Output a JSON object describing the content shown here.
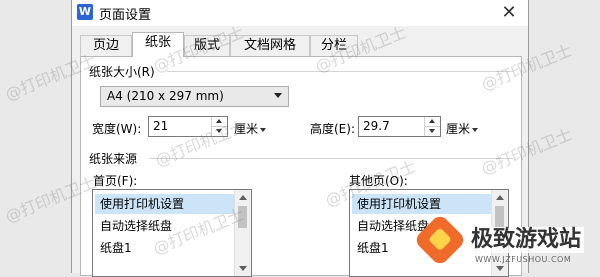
{
  "window": {
    "app_icon_letter": "W",
    "title": "页面设置",
    "close_glyph": "✕"
  },
  "tabs": [
    {
      "label": "页边距",
      "active": false
    },
    {
      "label": "纸张",
      "active": true
    },
    {
      "label": "版式",
      "active": false
    },
    {
      "label": "文档网格",
      "active": false
    },
    {
      "label": "分栏",
      "active": false
    }
  ],
  "paper_size": {
    "group_label": "纸张大小(R)",
    "selected": "A4 (210 x 297 mm)",
    "width_label": "宽度(W):",
    "width_value": "21",
    "width_unit": "厘米",
    "height_label": "高度(E):",
    "height_value": "29.7",
    "height_unit": "厘米"
  },
  "paper_source": {
    "group_label": "纸张来源",
    "first_page_label": "首页(F):",
    "first_page_items": [
      "使用打印机设置",
      "自动选择纸盘",
      "纸盘1"
    ],
    "other_pages_label": "其他页(O):",
    "other_pages_items": [
      "使用打印机设置",
      "自动选择纸盘",
      "纸盘1"
    ]
  },
  "watermark_text": "@打印机卫士",
  "brand": {
    "name": "极致游戏站",
    "url": "WWW.JZFUSHOU.COM"
  },
  "colors": {
    "selection": "#cce4f7",
    "app_icon": "#2b64d6",
    "brand_logo": "#f06a29"
  }
}
